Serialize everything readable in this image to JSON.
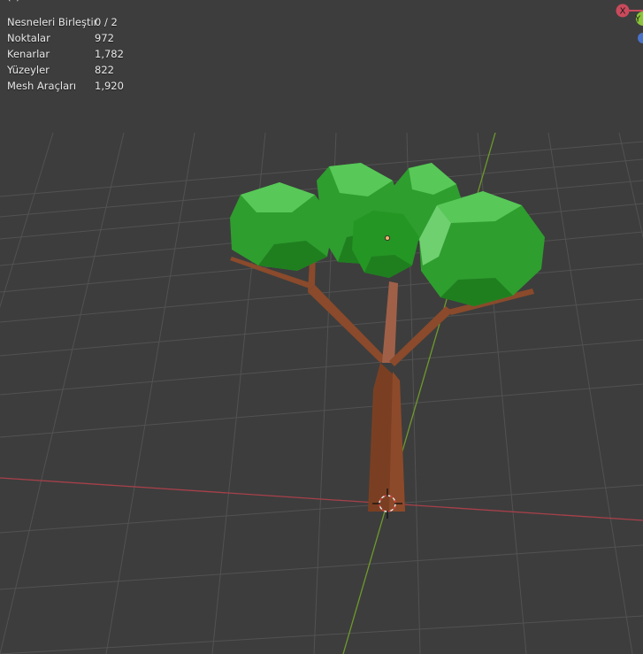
{
  "overlay": {
    "header_cut": "( ) · · · · · · · · · ·",
    "stats": [
      {
        "label": "Nesneleri Birleştir",
        "value": "0 / 2"
      },
      {
        "label": "Noktalar",
        "value": "972"
      },
      {
        "label": "Kenarlar",
        "value": "1,782"
      },
      {
        "label": "Yüzeyler",
        "value": "822"
      },
      {
        "label": "Mesh Araçları",
        "value": "1,920"
      }
    ]
  },
  "gizmo": {
    "x_label": "X",
    "y_label": "Y",
    "x_color": "#c94a5c",
    "y_color": "#8bc43a",
    "z_color": "#4a72c9"
  },
  "scene": {
    "background": "#3d3d3d",
    "grid_color": "#555555",
    "x_axis_color": "#a8404a",
    "y_axis_color": "#6f9a2c",
    "trunk_color": "#7a3f22",
    "foliage_colors": [
      "#2e9e2e",
      "#3cb63c",
      "#1f7f1f",
      "#58c858"
    ]
  }
}
